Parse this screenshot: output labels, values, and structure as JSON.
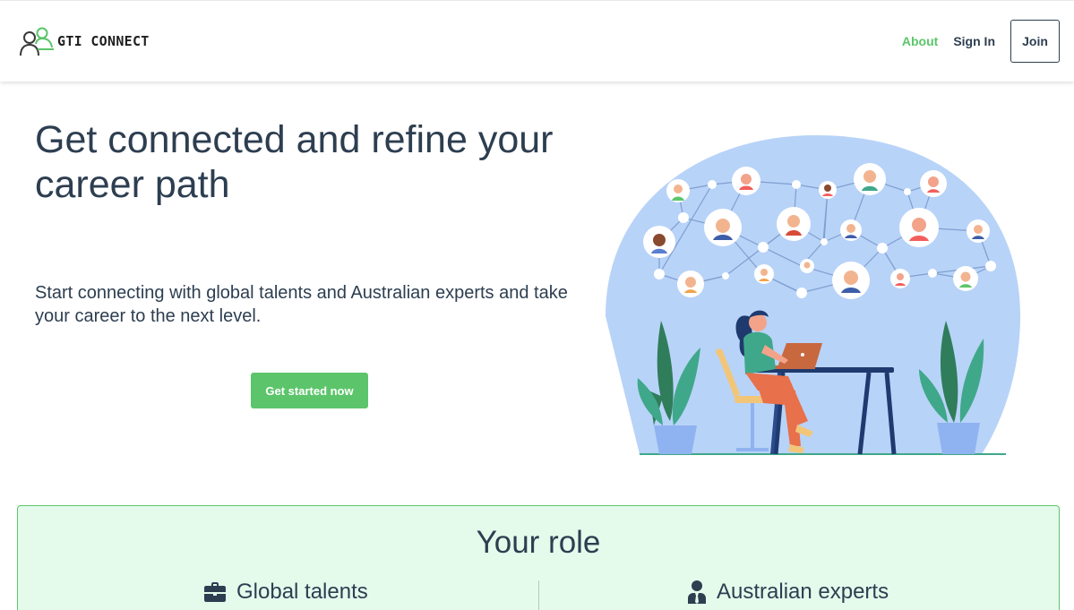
{
  "header": {
    "logo_text": "GTI CONNECT",
    "nav": {
      "about": "About",
      "sign_in": "Sign In",
      "join": "Join"
    }
  },
  "hero": {
    "title": "Get connected and refine your career path",
    "subtitle": "Start connecting with global talents and Australian experts and take your career to the next level.",
    "cta": "Get started now"
  },
  "roles": {
    "title": "Your role",
    "items": [
      {
        "label": "Global talents",
        "icon": "briefcase-icon"
      },
      {
        "label": "Australian experts",
        "icon": "user-tie-icon"
      }
    ]
  },
  "colors": {
    "accent": "#5cc56b",
    "text": "#2d3e50",
    "role_bg": "#e4fbec",
    "illustration_bg": "#b8d3f8"
  }
}
